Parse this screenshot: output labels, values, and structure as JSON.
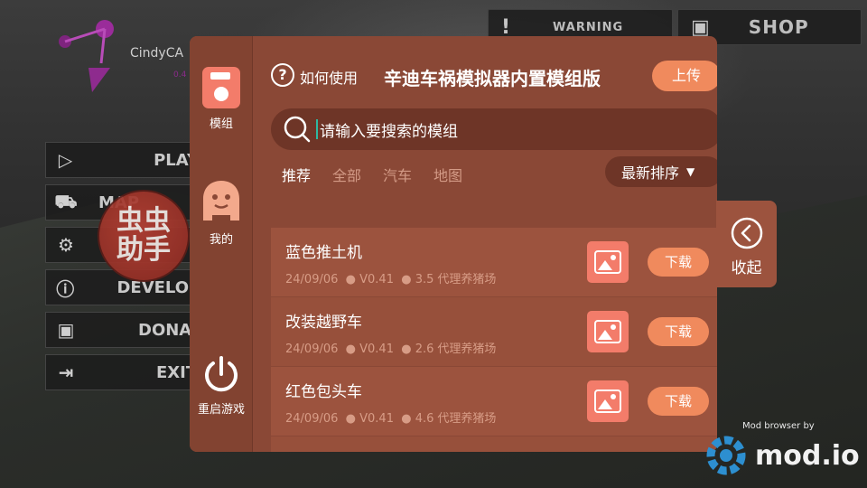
{
  "background": {
    "game_logo_text": "CindyCA",
    "game_logo_version": "0.4",
    "top_buttons": [
      {
        "label": "WARNING",
        "icon": "exclamation-icon"
      },
      {
        "label": "SHOP",
        "icon": "wallet-icon"
      }
    ],
    "menu": [
      {
        "label": "PLAY",
        "icon": "play-icon"
      },
      {
        "label": "MAP",
        "icon": "car-icon"
      },
      {
        "label": "",
        "icon": "gear-icon"
      },
      {
        "label": "DEVELOP",
        "icon": "info-icon"
      },
      {
        "label": "DONA",
        "icon": "wallet-icon"
      },
      {
        "label": "EXIT",
        "icon": "exit-icon"
      }
    ],
    "helper_badge": {
      "line1": "虫虫",
      "line2": "助手"
    },
    "modio": {
      "small": "Mod browser by",
      "brand": "mod.io"
    }
  },
  "panel": {
    "sidebar": {
      "mods_label": "模组",
      "mine_label": "我的",
      "restart_label": "重启游戏"
    },
    "help_label": "如何使用",
    "title": "辛迪车祸模拟器内置模组版",
    "upload_label": "上传",
    "search_placeholder": "请输入要搜索的模组",
    "tabs": [
      "推荐",
      "全部",
      "汽车",
      "地图"
    ],
    "active_tab": "推荐",
    "sort_label": "最新排序",
    "collapse_label": "收起",
    "mods": [
      {
        "name": "蓝色推土机",
        "date": "24/09/06",
        "version": "V0.41",
        "size": "3.5",
        "author": "代理养猪场",
        "download_label": "下载"
      },
      {
        "name": "改装越野车",
        "date": "24/09/06",
        "version": "V0.41",
        "size": "2.6",
        "author": "代理养猪场",
        "download_label": "下载"
      },
      {
        "name": "红色包头车",
        "date": "24/09/06",
        "version": "V0.41",
        "size": "4.6",
        "author": "代理养猪场",
        "download_label": "下载"
      }
    ]
  },
  "colors": {
    "panel": "#8a4836",
    "accent": "#f08a5d",
    "row": "#9c533e"
  }
}
